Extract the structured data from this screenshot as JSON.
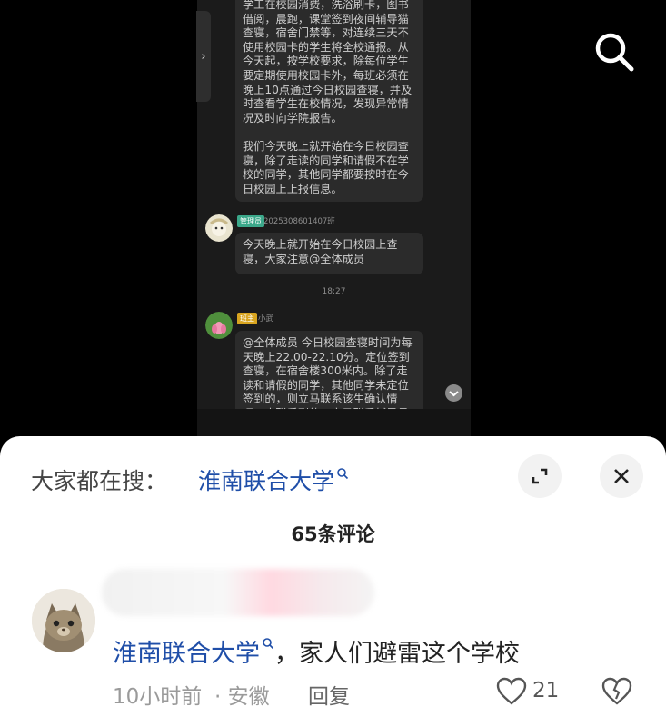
{
  "chat": {
    "msg1": "学工在校园消费，洗浴刷卡，图书借阅，晨跑，课堂签到夜间辅导猫查寝，宿舍门禁等，对连续三天不使用校园卡的学生将全校通报。从今天起，按学校要求，除每位学生要定期使用校园卡外，每班必须在晚上10点通过今日校园查寝，并及时查看学生在校情况，发现异常情况及时向学院报告。\n\n我们今天晚上就开始在今日校园查寝，除了走读的同学和请假不在学校的同学，其他同学都要按时在今日校园上上报信息。",
    "sender2_role": "管理员",
    "sender2_name": "2025308601407班",
    "msg2": "今天晚上就开始在今日校园上查寝，大家注意@全体成员",
    "time": "18:27",
    "sender3_role": "班主",
    "sender3_name": "小武",
    "msg3": "@全体成员 今日校园查寝时间为每天晚上22.00-22.10分。定位签到查寝，在宿舍楼300米内。除了走读和请假的同学，其他同学未定位签到的，则立马联系该生确认情况，未联系到的，立马联系辅导员"
  },
  "hot_search": {
    "label": "大家都在搜：",
    "query": "淮南联合大学"
  },
  "comments_count": "65条评论",
  "comment": {
    "link": "淮南联合大学",
    "text": "，家人们避雷这个学校",
    "time": "10小时前",
    "location": "· 安徽",
    "reply": "回复",
    "likes": "21"
  },
  "colors": {
    "link": "#1f4ea8",
    "chat_bg": "#1b1b1b",
    "bubble": "#2b2b2b",
    "admin_tag": "#3ba88a",
    "owner_tag": "#d9a520"
  }
}
